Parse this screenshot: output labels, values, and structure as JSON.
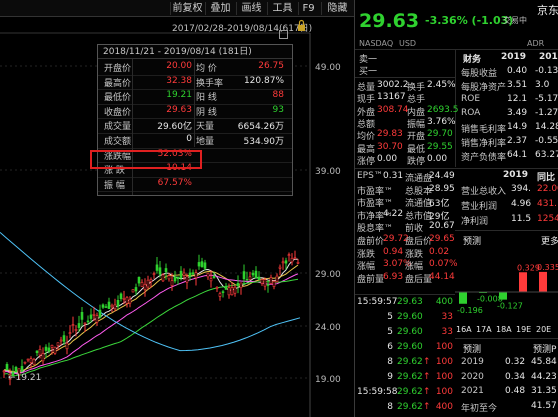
{
  "toolbar": {
    "buttons": [
      "前复权",
      "叠加",
      "画线",
      "工具",
      "F9",
      "隐藏"
    ]
  },
  "chart": {
    "range_text": "2017/02/28-2019/08/14(617日)",
    "y_labels": [
      "49.00",
      "39.00",
      "29.00",
      "24.00",
      "19.00"
    ],
    "low_marker": "←19.21",
    "colors": {
      "up": "#ff3b3b",
      "down": "#2fd12f",
      "ma_white": "#e6e6e6",
      "ma_yellow": "#e8c44a",
      "ma_magenta": "#ff5cf0",
      "ma_green": "#3bd63b",
      "ma_cyan": "#4fc3f7"
    }
  },
  "popup": {
    "title": "2018/11/21 - 2019/08/14 (181日)",
    "rows": [
      {
        "l1": "开盘价",
        "v1": "20.00",
        "l2": "均 价",
        "v2": "26.75"
      },
      {
        "l1": "最高价",
        "v1": "32.38",
        "l2": "换手率",
        "v2": "120.87%"
      },
      {
        "l1": "最低价",
        "v1": "19.21",
        "l2": "阳 线",
        "v2": "88"
      },
      {
        "l1": "收盘价",
        "v1": "29.63",
        "l2": "阴 线",
        "v2": "93"
      },
      {
        "l1": "成交量",
        "v1": "29.60亿",
        "l2": "天量",
        "v2": "6654.26万"
      },
      {
        "l1": "成交额",
        "v1": "0",
        "l2": "地量",
        "v2": "534.90万"
      },
      {
        "l1": "涨跌幅",
        "v1": "52.03%",
        "l2": "",
        "v2": ""
      },
      {
        "l1": "涨 跌",
        "v1": "10.14",
        "l2": "",
        "v2": ""
      },
      {
        "l1": "振 幅",
        "v1": "67.57%",
        "l2": "",
        "v2": ""
      }
    ]
  },
  "quote": {
    "title_partial": "京东",
    "price": "29.63",
    "change": "-3.36% (-1.03)",
    "trade_label": "交易中",
    "exchange": "NASDAQ",
    "currency": "USD",
    "adr": "ADR",
    "sell_label": "卖一",
    "buy_label": "买一"
  },
  "stats": [
    {
      "l": "总量",
      "v": "3002.2",
      "l2": "换手",
      "v2": "2.45%"
    },
    {
      "l": "现手",
      "v": "13167",
      "l2": "总手",
      "v2": ""
    },
    {
      "l": "外盘",
      "v": "308.74",
      "l2": "内盘",
      "v2": "2693.5"
    },
    {
      "l": "总额",
      "v": "",
      "l2": "振幅",
      "v2": "3.76%"
    },
    {
      "l": "均价",
      "v": "29.83",
      "l2": "开盘",
      "v2": "29.70"
    },
    {
      "l": "最高",
      "v": "30.70",
      "l2": "最低",
      "v2": "29.55"
    },
    {
      "l": "涨停",
      "v": "0.00",
      "l2": "跌停",
      "v2": "0.00"
    }
  ],
  "finance": {
    "header": "财务",
    "year": "2019",
    "year2": "2018",
    "rows": [
      {
        "l": "每股收益",
        "v": "0.40",
        "v2": "-0.13"
      },
      {
        "l": "每股净资产",
        "v": "3.51",
        "v2": "3.0"
      },
      {
        "l": "ROE",
        "v": "12.1",
        "v2": "-5.17"
      },
      {
        "l": "ROA",
        "v": "3.49",
        "v2": "-1.27"
      },
      {
        "l": "销售毛利率",
        "v": "14.9",
        "v2": "14.28"
      },
      {
        "l": "销售净利率",
        "v": "2.37",
        "v2": "-0.55"
      },
      {
        "l": "资产负债率",
        "v": "64.1",
        "v2": "63.27"
      }
    ]
  },
  "valuation": [
    {
      "l": "EPS™",
      "v": "0.31",
      "l2": "流通盘",
      "v2": "24.49"
    },
    {
      "l": "市盈率™",
      "v": "",
      "l2": "总股本",
      "v2": "28.95"
    },
    {
      "l": "市盈率™",
      "v": "",
      "l2": "流通值",
      "v2": "63亿"
    },
    {
      "l": "市净率™",
      "v": "4.22",
      "l2": "总市值",
      "v2": "29亿"
    },
    {
      "l": "股息率™",
      "v": "",
      "l2": "前收",
      "v2": "20.67"
    },
    {
      "l": "盘前价",
      "v": "29.72",
      "l2": "盘后价",
      "v2": "29.65"
    },
    {
      "l": "涨跌",
      "v": "0.94",
      "l2": "涨跌",
      "v2": "0.02"
    },
    {
      "l": "涨幅",
      "v": "3.07%",
      "l2": "涨幅",
      "v2": "0.07%"
    },
    {
      "l": "盘前量",
      "v": "6.93",
      "l2": "盘后量",
      "v2": "44.14"
    }
  ],
  "annual": {
    "header": "2019",
    "header2": "同比",
    "rows": [
      {
        "l": "营业总收入",
        "v": "394.",
        "v2": "22.00"
      },
      {
        "l": "营业利润",
        "v": "4.96",
        "v2": "431.1"
      },
      {
        "l": "净利润",
        "v": "11.5",
        "v2": "1254"
      }
    ]
  },
  "forecast": {
    "label": "预测",
    "more": "更多",
    "bars": [
      "-0.196",
      "-0.008",
      "-0.127",
      "0.329",
      "0.335"
    ],
    "quarters": [
      "16A",
      "17A",
      "18A",
      "19E",
      "20E"
    ],
    "table_header": "预测",
    "table_col": "预测P",
    "table": [
      {
        "y": "2019",
        "v": "0.32",
        "v2": "45.84"
      },
      {
        "y": "2020",
        "v": "0.34",
        "v2": "44.23"
      },
      {
        "y": "2021",
        "v": "0.48",
        "v2": "31.35"
      },
      {
        "y": "年初至今",
        "v": "",
        "v2": "41.57"
      }
    ]
  },
  "ticks": [
    {
      "t": "15:59:57",
      "p": "29.63",
      "d": "",
      "v": "400"
    },
    {
      "t": "5",
      "p": "29.60",
      "d": "",
      "v": "33"
    },
    {
      "t": "5",
      "p": "29.60",
      "d": "",
      "v": "33"
    },
    {
      "t": "6",
      "p": "29.60",
      "d": "",
      "v": "100"
    },
    {
      "t": "8",
      "p": "29.62",
      "d": "↑",
      "v": "100"
    },
    {
      "t": "9",
      "p": "29.62",
      "d": "↑",
      "v": "100"
    },
    {
      "t": "15:59:58",
      "p": "29.62",
      "d": "↑",
      "v": "100"
    },
    {
      "t": "8",
      "p": "29.62",
      "d": "↑",
      "v": "400"
    }
  ]
}
